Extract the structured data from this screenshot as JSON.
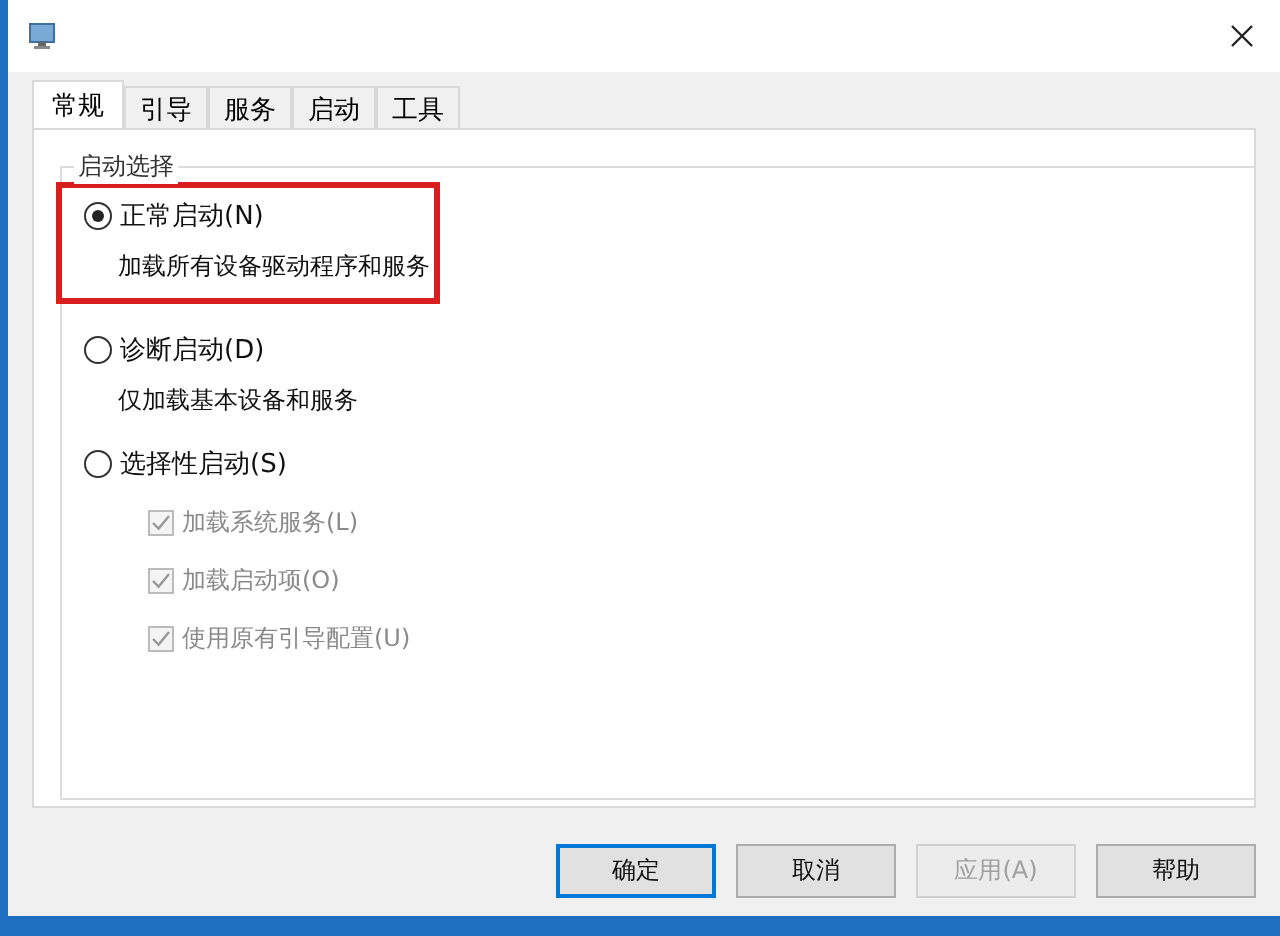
{
  "tabs": [
    {
      "label": "常规",
      "selected": true
    },
    {
      "label": "引导",
      "selected": false
    },
    {
      "label": "服务",
      "selected": false
    },
    {
      "label": "启动",
      "selected": false
    },
    {
      "label": "工具",
      "selected": false
    }
  ],
  "group": {
    "title": "启动选择"
  },
  "options": [
    {
      "label": "正常启动(N)",
      "description": "加载所有设备驱动程序和服务",
      "selected": true,
      "highlighted": true
    },
    {
      "label": "诊断启动(D)",
      "description": "仅加载基本设备和服务",
      "selected": false,
      "highlighted": false
    },
    {
      "label": "选择性启动(S)",
      "selected": false,
      "highlighted": false
    }
  ],
  "checkboxes": [
    {
      "label": "加载系统服务(L)",
      "checked": true,
      "disabled": true
    },
    {
      "label": "加载启动项(O)",
      "checked": true,
      "disabled": true
    },
    {
      "label": "使用原有引导配置(U)",
      "checked": true,
      "disabled": true
    }
  ],
  "buttons": [
    {
      "label": "确定",
      "default": true,
      "disabled": false
    },
    {
      "label": "取消",
      "default": false,
      "disabled": false
    },
    {
      "label": "应用(A)",
      "default": false,
      "disabled": true
    },
    {
      "label": "帮助",
      "default": false,
      "disabled": false
    }
  ]
}
